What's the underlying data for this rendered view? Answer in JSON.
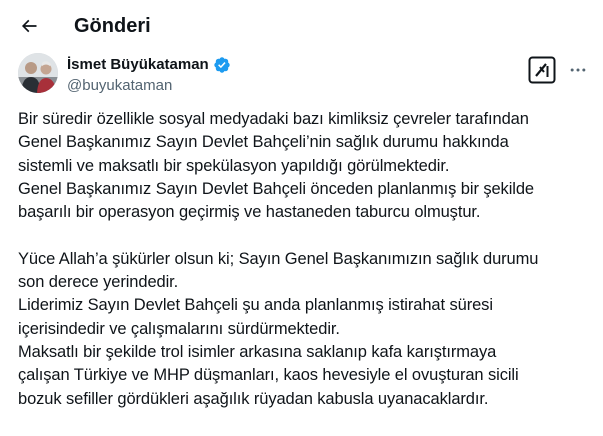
{
  "header": {
    "title": "Gönderi"
  },
  "author": {
    "display_name": "İsmet Büyükataman",
    "handle": "@buyukataman",
    "verified": true
  },
  "icons": {
    "back": "arrow-left-icon",
    "verified": "verified-badge-icon",
    "grok": "grok-icon",
    "more": "more-horizontal-icon"
  },
  "colors": {
    "verified_blue": "#1d9bf0",
    "secondary_text": "#536471",
    "primary_text": "#0f1419"
  },
  "post": {
    "lines": [
      "Bir süredir özellikle sosyal medyadaki bazı kimliksiz çevreler tarafından",
      "Genel Başkanımız Sayın Devlet Bahçeli’nin sağlık durumu hakkında",
      "sistemli ve maksatlı bir spekülasyon yapıldığı görülmektedir.",
      "Genel Başkanımız Sayın Devlet Bahçeli önceden planlanmış bir şekilde",
      "başarılı bir operasyon geçirmiş ve hastaneden taburcu olmuştur.",
      "",
      "Yüce Allah’a şükürler olsun ki; Sayın Genel Başkanımızın sağlık durumu",
      "son derece yerindedir.",
      "Liderimiz Sayın Devlet Bahçeli şu anda planlanmış istirahat süresi",
      "içerisindedir ve çalışmalarını sürdürmektedir.",
      "Maksatlı bir şekilde trol isimler arkasına saklanıp kafa karıştırmaya",
      "çalışan Türkiye ve MHP düşmanları, kaos hevesiyle el ovuşturan sicili",
      "bozuk sefiller gördükleri aşağılık rüyadan kabusla uyanacaklardır."
    ]
  }
}
